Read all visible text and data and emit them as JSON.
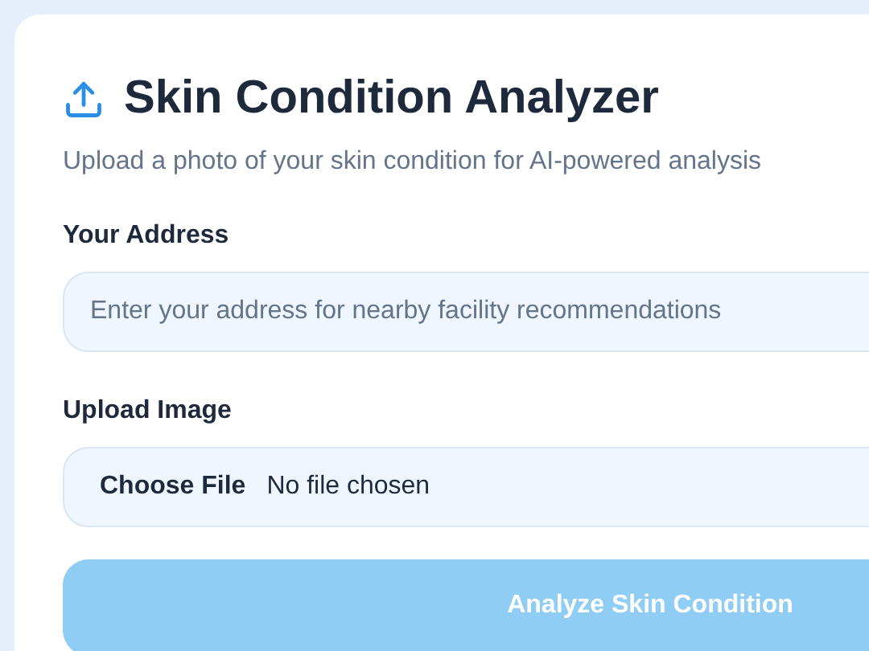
{
  "header": {
    "title": "Skin Condition Analyzer",
    "subtitle": "Upload a photo of your skin condition for AI-powered analysis"
  },
  "address": {
    "label": "Your Address",
    "placeholder": "Enter your address for nearby facility recommendations"
  },
  "upload": {
    "label": "Upload Image",
    "button": "Choose File",
    "status": "No file chosen"
  },
  "submit": {
    "label": "Analyze Skin Condition",
    "disabled": true
  }
}
